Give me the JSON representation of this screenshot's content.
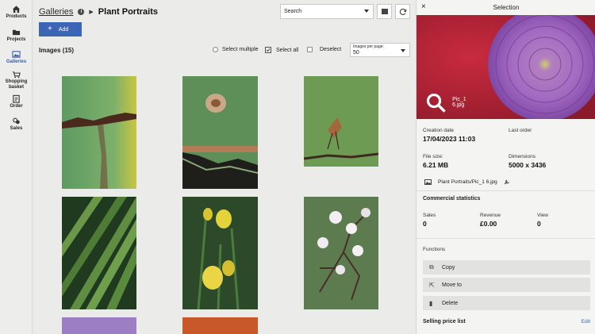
{
  "nav": [
    {
      "label": "Products",
      "icon": "home-icon"
    },
    {
      "label": "Projects",
      "icon": "folder-icon"
    },
    {
      "label": "Galleries",
      "icon": "gallery-icon"
    },
    {
      "label": "Shopping basket",
      "icon": "basket-icon"
    },
    {
      "label": "Order",
      "icon": "order-icon"
    },
    {
      "label": "Sales",
      "icon": "sales-icon"
    }
  ],
  "header": {
    "breadcrumb_link": "Galleries",
    "info": "i",
    "title": "Plant Portraits",
    "search_label": "Search"
  },
  "toolbar": {
    "add_label": "Add",
    "add_icon": "+",
    "images_count": "Images (15)",
    "select_multiple": "Select multiple",
    "select_all": "Select all",
    "deselect": "Deselect",
    "per_page_label": "Images per page:",
    "per_page_value": "50"
  },
  "selection": {
    "title": "Selection",
    "close": "×",
    "filename": "Pic_1 6.jpg",
    "creation_date_label": "Creation date",
    "creation_date": "17/04/2023 11:03",
    "last_order_label": "Last order",
    "file_size_label": "File size:",
    "file_size": "6.21 MB",
    "dimensions_label": "Dimensions",
    "dimensions": "5000 x 3436",
    "path": "Plant Portraits/Pic_1 6.jpg",
    "commercial_title": "Commercial statistics",
    "sales_label": "Sales",
    "sales": "0",
    "revenue_label": "Revenue",
    "revenue": "£0.00",
    "view_label": "View",
    "view": "0",
    "functions_title": "Functions",
    "copy": "Copy",
    "move_to": "Move to",
    "delete": "Delete",
    "selling_price_list": "Selling price list",
    "edit": "Edit"
  },
  "colors": {
    "accent": "#3e64b5",
    "sidebar_bg": "#ededec",
    "main_bg": "#ebebea",
    "panel_bg": "#f4f4f3"
  }
}
